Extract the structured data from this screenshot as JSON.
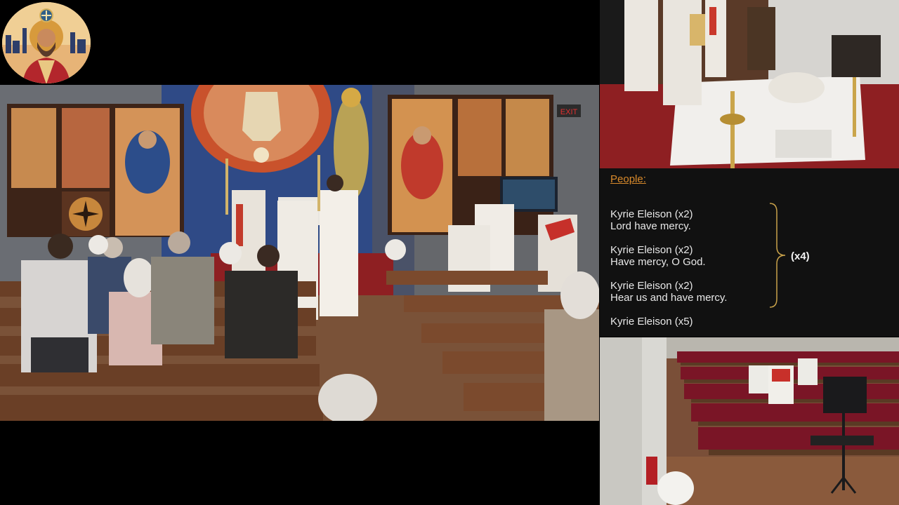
{
  "lyrics": {
    "heading": "People:",
    "lines": [
      "Kyrie Eleison (x2)",
      "Lord have mercy.",
      "Kyrie Eleison (x2)",
      "Have mercy, O God.",
      "Kyrie Eleison (x2)",
      "Hear us and have mercy.",
      "Kyrie Eleison (x5)"
    ],
    "repeat": "(x4)"
  },
  "sign": {
    "exit": "EXIT"
  },
  "colors": {
    "heading": "#d98a2b",
    "text": "#e8e8e8",
    "brace": "#c9a24a",
    "background": "#000000",
    "carpet": "#8e1f22"
  },
  "icons": [
    "church-logo-icon"
  ]
}
